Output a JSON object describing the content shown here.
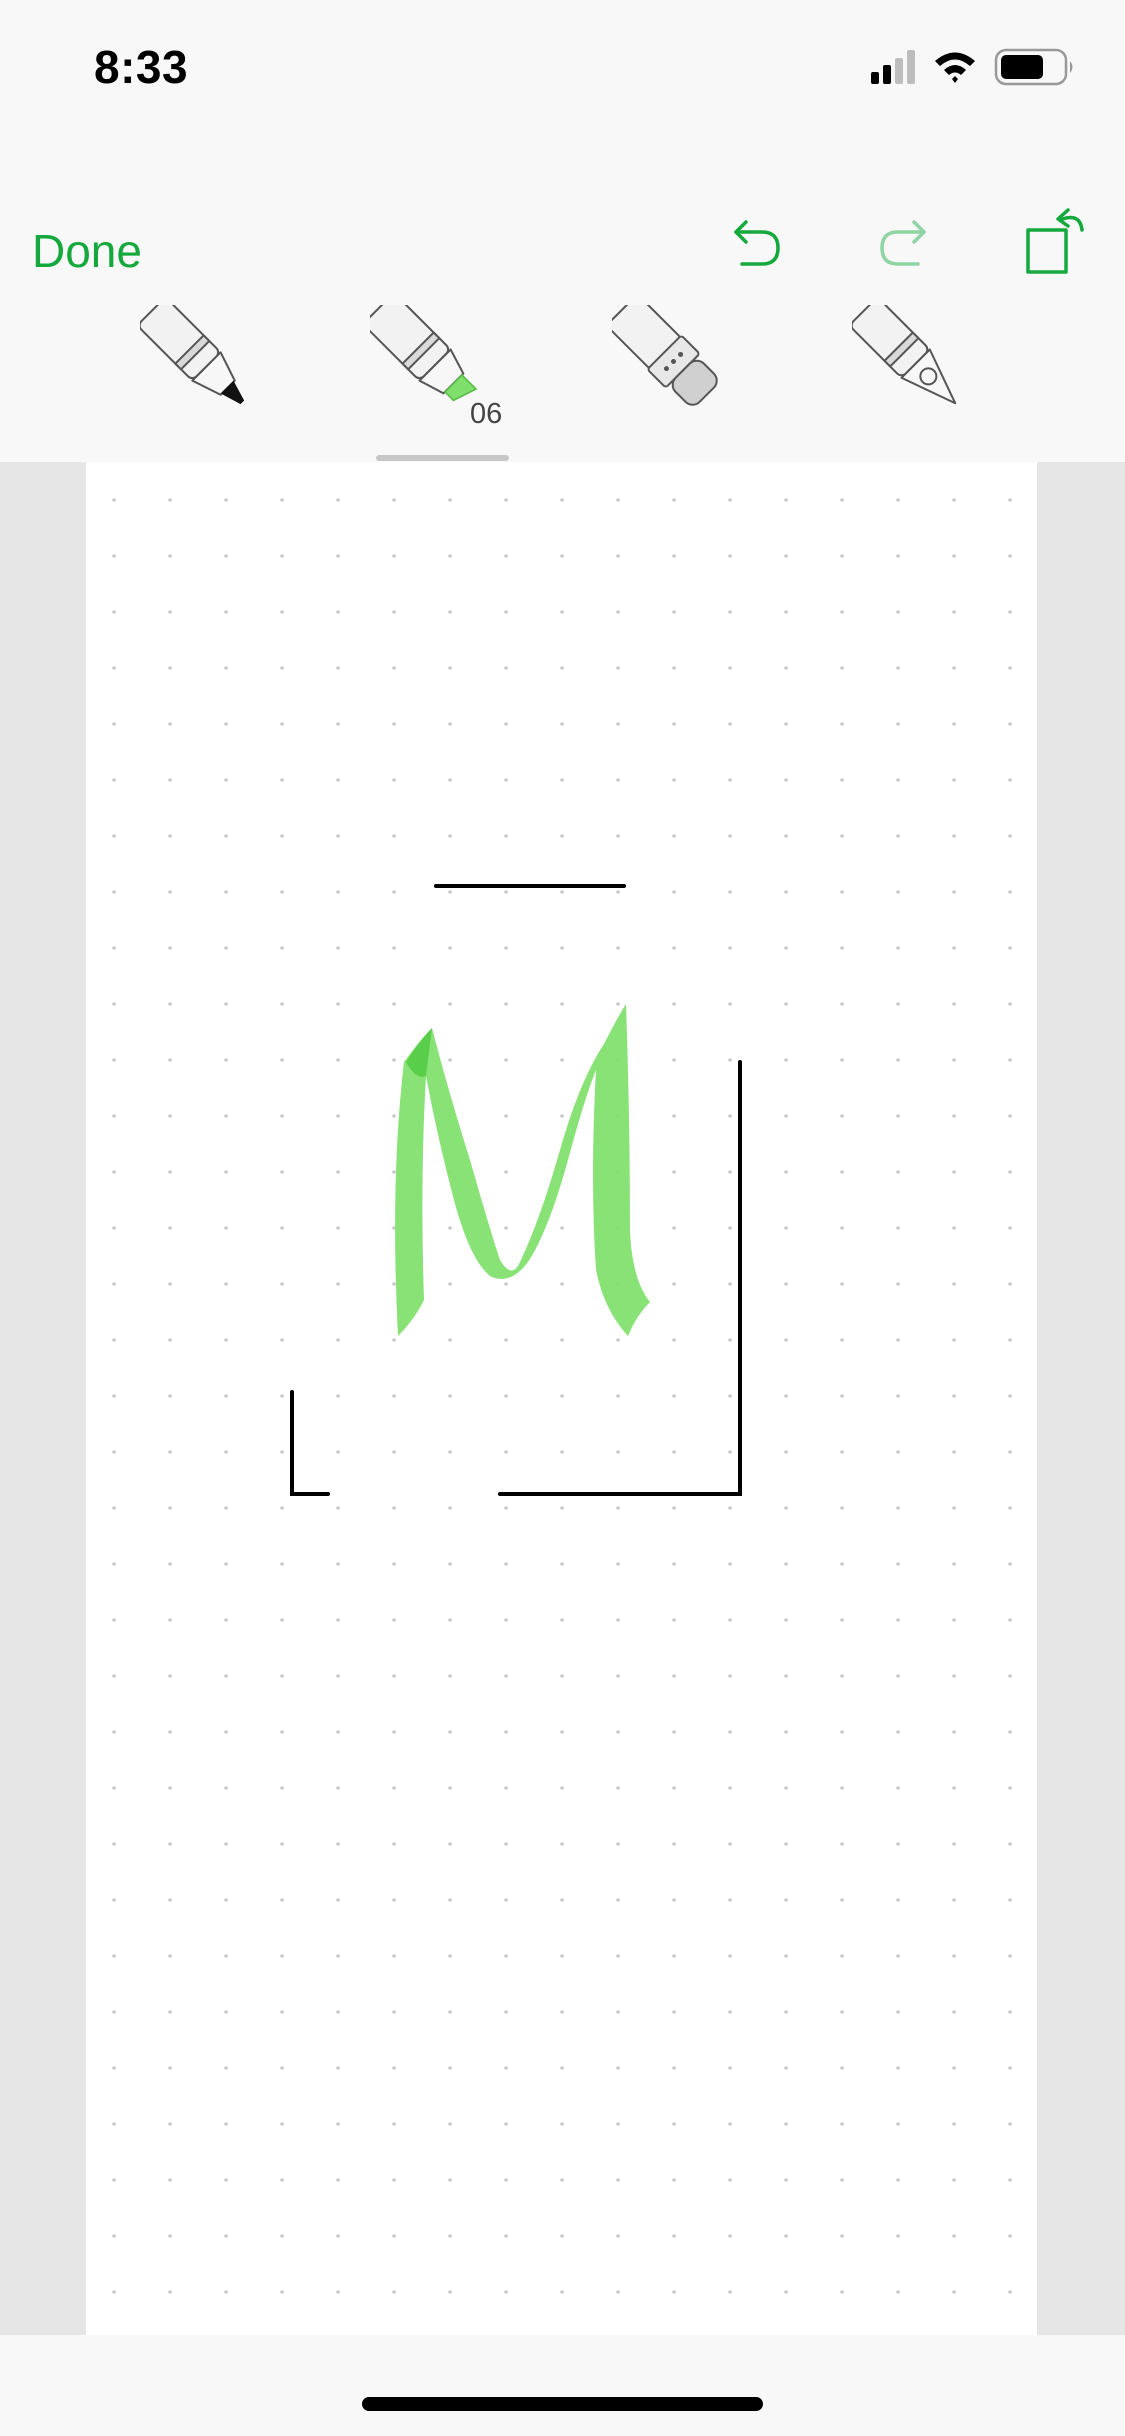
{
  "status_bar": {
    "time": "8:33"
  },
  "toolbar": {
    "done_label": "Done",
    "undo_icon": "undo-arrow-icon",
    "redo_icon": "redo-arrow-icon",
    "rotate_icon": "rotate-page-icon"
  },
  "tools": [
    {
      "name": "pen",
      "icon": "pen-tool-icon"
    },
    {
      "name": "highlighter",
      "icon": "highlighter-tool-icon",
      "size_label": "06",
      "selected": true,
      "tip_color": "#7ee06a"
    },
    {
      "name": "eraser",
      "icon": "eraser-tool-icon"
    },
    {
      "name": "lasso",
      "icon": "lasso-tool-icon"
    }
  ],
  "colors": {
    "accent": "#14a83d",
    "highlight_stroke": "#7ee06a",
    "ink": "#000000"
  }
}
